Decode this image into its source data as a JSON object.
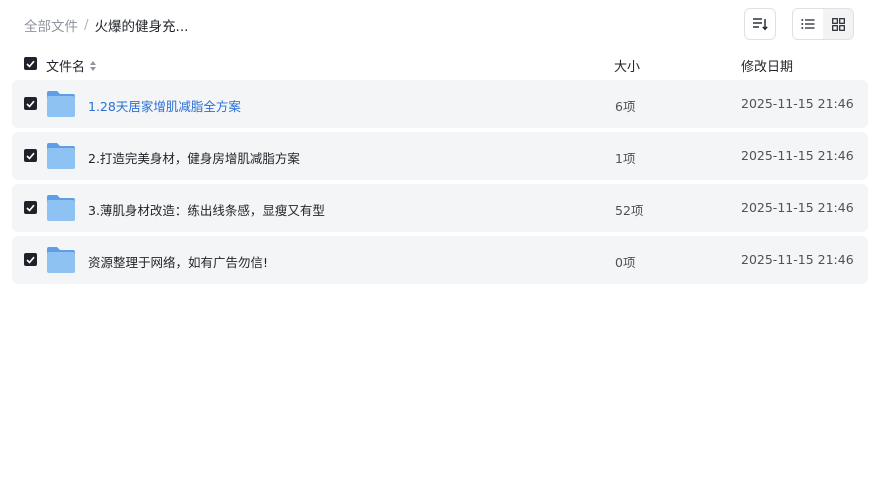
{
  "breadcrumb": {
    "root": "全部文件",
    "separator": "/",
    "current": "火爆的健身充..."
  },
  "toolbar": {
    "sort_icon": "sort-lines-icon",
    "list_view_icon": "list-view-icon",
    "grid_view_icon": "grid-view-icon"
  },
  "table": {
    "headers": {
      "name": "文件名",
      "size": "大小",
      "date": "修改日期"
    },
    "rows": [
      {
        "name": "1.28天居家增肌减脂全方案",
        "size": "6项",
        "date": "2025-11-15 21:46"
      },
      {
        "name": "2.打造完美身材，健身房增肌减脂方案",
        "size": "1项",
        "date": "2025-11-15 21:46"
      },
      {
        "name": "3.薄肌身材改造：练出线条感，显瘦又有型",
        "size": "52项",
        "date": "2025-11-15 21:46"
      },
      {
        "name": "资源整理于网络，如有广告勿信!",
        "size": "0项",
        "date": "2025-11-15 21:46"
      }
    ]
  },
  "colors": {
    "link": "#2a6fd6",
    "row_bg": "#f4f5f6",
    "folder": "#7fb6ef"
  }
}
